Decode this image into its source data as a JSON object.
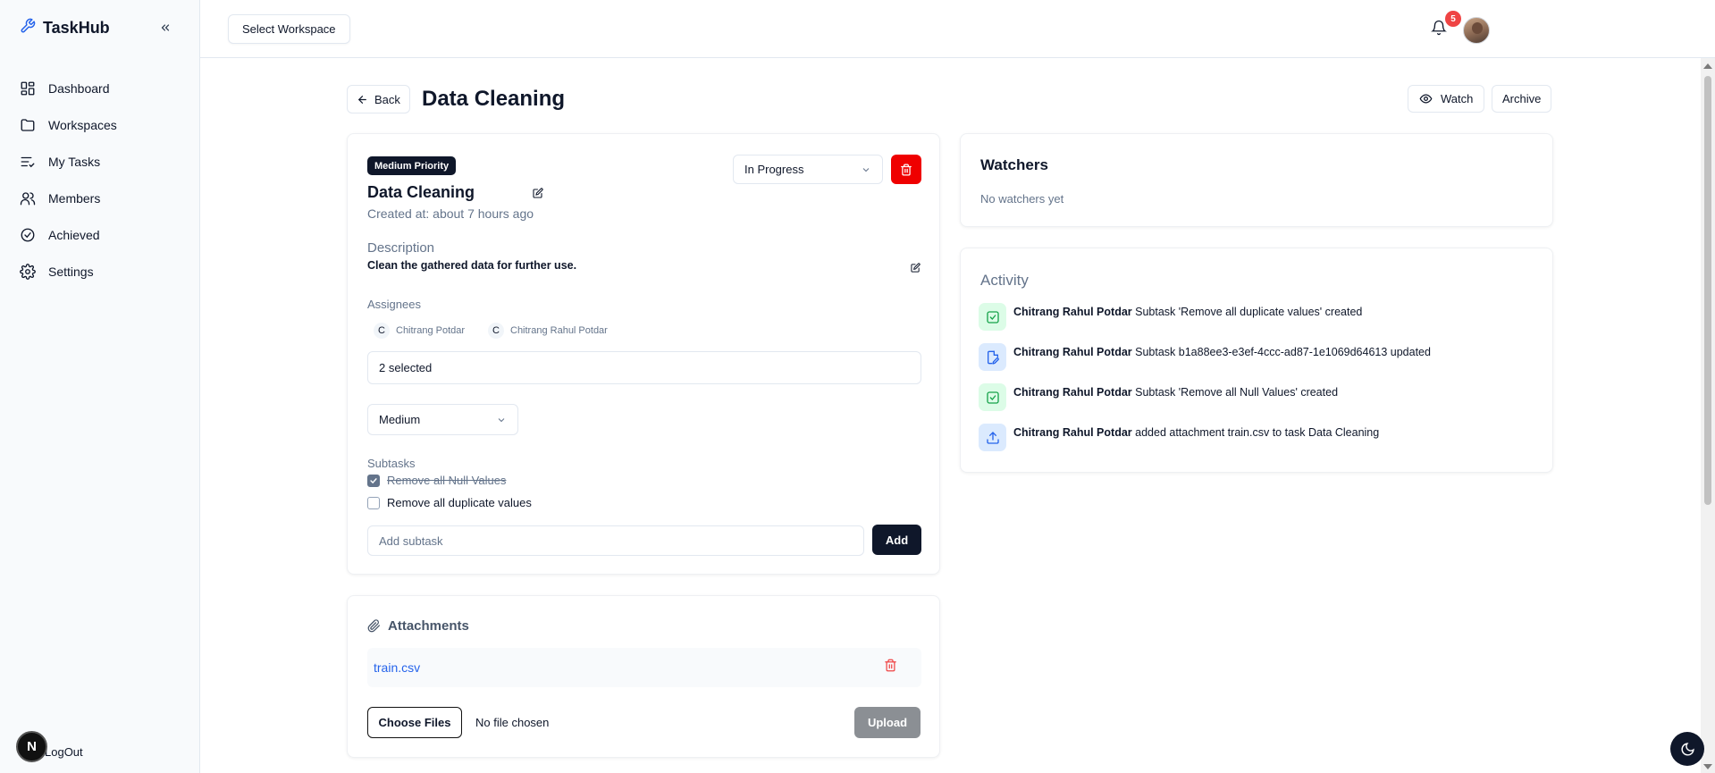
{
  "app": {
    "name": "TaskHub"
  },
  "sidebar": {
    "items": [
      {
        "label": "Dashboard",
        "icon": "dashboard-icon"
      },
      {
        "label": "Workspaces",
        "icon": "folder-icon"
      },
      {
        "label": "My Tasks",
        "icon": "list-check-icon"
      },
      {
        "label": "Members",
        "icon": "users-icon"
      },
      {
        "label": "Achieved",
        "icon": "check-circle-icon"
      },
      {
        "label": "Settings",
        "icon": "gear-icon"
      }
    ],
    "logout_label": "LogOut",
    "next_badge": "N"
  },
  "topbar": {
    "workspace_button": "Select Workspace",
    "notification_count": "5"
  },
  "header": {
    "back_label": "Back",
    "title": "Data Cleaning",
    "watch_label": "Watch",
    "archive_label": "Archive"
  },
  "task": {
    "priority_badge": "Medium Priority",
    "name": "Data Cleaning",
    "created": "Created at: about 7 hours ago",
    "status": "In Progress",
    "description_label": "Description",
    "description": "Clean the gathered data for further use.",
    "assignees_label": "Assignees",
    "assignees": [
      {
        "initial": "C",
        "name": "Chitrang Potdar"
      },
      {
        "initial": "C",
        "name": "Chitrang Rahul Potdar"
      }
    ],
    "assignee_select": "2 selected",
    "priority_select": "Medium",
    "subtasks_label": "Subtasks",
    "subtasks": [
      {
        "label": "Remove all Null Values",
        "done": true
      },
      {
        "label": "Remove all duplicate values",
        "done": false
      }
    ],
    "add_subtask_placeholder": "Add subtask",
    "add_label": "Add"
  },
  "attachments": {
    "title": "Attachments",
    "files": [
      {
        "name": "train.csv"
      }
    ],
    "choose_label": "Choose Files",
    "no_file": "No file chosen",
    "upload_label": "Upload"
  },
  "watchers": {
    "title": "Watchers",
    "empty": "No watchers yet"
  },
  "activity": {
    "title": "Activity",
    "items": [
      {
        "user": "Chitrang Rahul Potdar",
        "text": "Subtask 'Remove all duplicate values' created",
        "icon": "check-square-icon",
        "color": "#16a34a"
      },
      {
        "user": "Chitrang Rahul Potdar",
        "text": "Subtask b1a88ee3-e3ef-4ccc-ad87-1e1069d64613 updated",
        "icon": "file-edit-icon",
        "color": "#2563eb"
      },
      {
        "user": "Chitrang Rahul Potdar",
        "text": "Subtask 'Remove all Null Values' created",
        "icon": "check-square-icon",
        "color": "#16a34a"
      },
      {
        "user": "Chitrang Rahul Potdar",
        "text": "added attachment train.csv to task Data Cleaning",
        "icon": "upload-icon",
        "color": "#2563eb"
      }
    ]
  },
  "colors": {
    "accent": "#0f172a",
    "danger": "#ef0000",
    "link": "#2563eb",
    "muted": "#64748b"
  }
}
